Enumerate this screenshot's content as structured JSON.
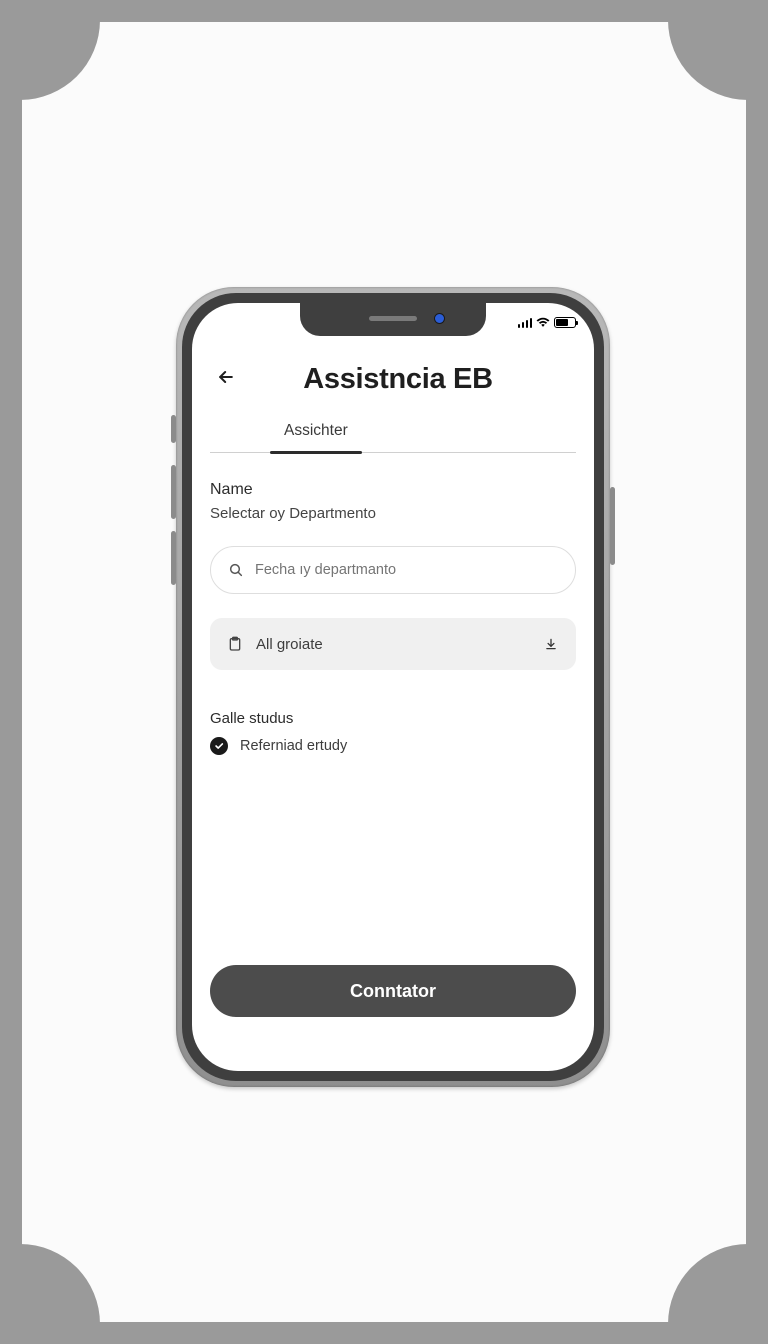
{
  "header": {
    "title": "Assistncia EB"
  },
  "tabs": [
    {
      "label": "Assichter",
      "active": true
    }
  ],
  "form": {
    "name_label": "Name",
    "name_sub": "Selectar oy Departmento",
    "search": {
      "placeholder": "Fecha ıy departmanto"
    },
    "select": {
      "label": "All groiate"
    },
    "status_heading": "Galle studus",
    "status_item": "Referniad ertudy"
  },
  "cta_label": "Conntator"
}
